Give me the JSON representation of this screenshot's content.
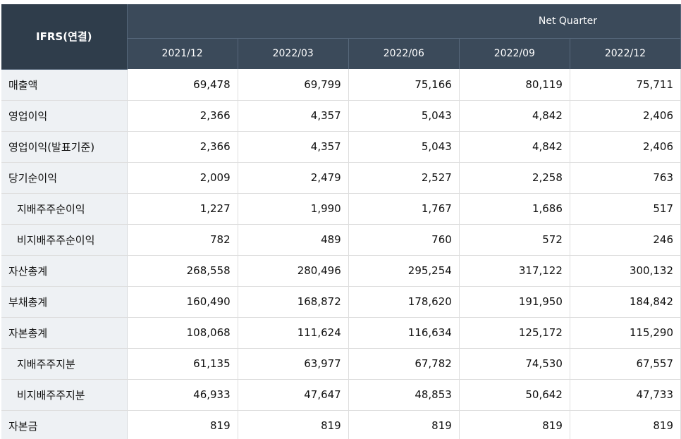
{
  "header": {
    "corner_label": "IFRS(연결)",
    "period_label": "Net Quarter",
    "columns": [
      "2021/12",
      "2022/03",
      "2022/06",
      "2022/09",
      "2022/12"
    ]
  },
  "rows": [
    {
      "label": "매출액",
      "values": [
        "69,478",
        "69,799",
        "75,166",
        "80,119",
        "75,711"
      ]
    },
    {
      "label": "영업이익",
      "values": [
        "2,366",
        "4,357",
        "5,043",
        "4,842",
        "2,406"
      ]
    },
    {
      "label": "영업이익(발표기준)",
      "values": [
        "2,366",
        "4,357",
        "5,043",
        "4,842",
        "2,406"
      ]
    },
    {
      "label": "당기순이익",
      "values": [
        "2,009",
        "2,479",
        "2,527",
        "2,258",
        "763"
      ]
    },
    {
      "label": "지배주주순이익",
      "values": [
        "1,227",
        "1,990",
        "1,767",
        "1,686",
        "517"
      ]
    },
    {
      "label": "비지배주주순이익",
      "values": [
        "782",
        "489",
        "760",
        "572",
        "246"
      ]
    },
    {
      "label": "자산총계",
      "values": [
        "268,558",
        "280,496",
        "295,254",
        "317,122",
        "300,132"
      ]
    },
    {
      "label": "부채총계",
      "values": [
        "160,490",
        "168,872",
        "178,620",
        "191,950",
        "184,842"
      ]
    },
    {
      "label": "자본총계",
      "values": [
        "108,068",
        "111,624",
        "116,634",
        "125,172",
        "115,290"
      ]
    },
    {
      "label": "지배주주지분",
      "values": [
        "61,135",
        "63,977",
        "67,782",
        "74,530",
        "67,557"
      ]
    },
    {
      "label": "비지배주주지분",
      "values": [
        "46,933",
        "47,647",
        "48,853",
        "50,642",
        "47,733"
      ]
    },
    {
      "label": "자본금",
      "values": [
        "819",
        "819",
        "819",
        "819",
        "819"
      ]
    }
  ]
}
